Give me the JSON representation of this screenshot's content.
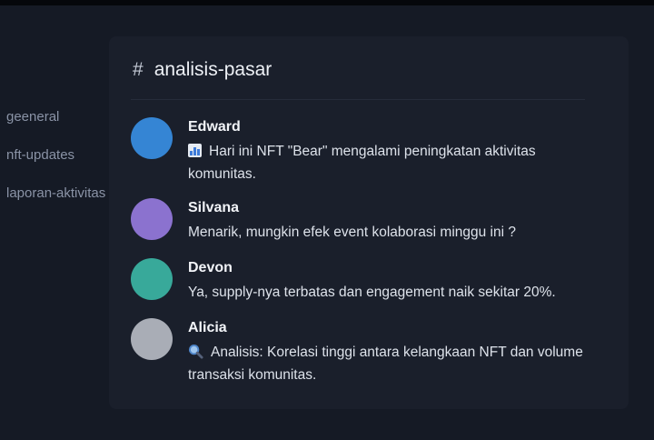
{
  "sidebar": {
    "channels": [
      "geeneral",
      "nft-updates",
      "laporan-aktivitas"
    ]
  },
  "channel": {
    "hash": "#",
    "name": "analisis-pasar"
  },
  "messages": [
    {
      "author": "Edward",
      "avatar_color": "#3585d4",
      "icon": "bar-chart-icon",
      "text": "Hari ini NFT \"Bear\" mengalami peningkatan aktivitas komunitas."
    },
    {
      "author": "Silvana",
      "avatar_color": "#8b72cf",
      "icon": null,
      "text": "Menarik, mungkin efek event kolaborasi minggu ini ?"
    },
    {
      "author": "Devon",
      "avatar_color": "#38a99a",
      "icon": null,
      "text": "Ya, supply-nya terbatas dan engagement naik sekitar 20%."
    },
    {
      "author": "Alicia",
      "avatar_color": "#a9adb6",
      "icon": "magnifier-icon",
      "text": "Analisis: Korelasi tinggi antara kelangkaan NFT dan volume transaksi komunitas."
    }
  ]
}
